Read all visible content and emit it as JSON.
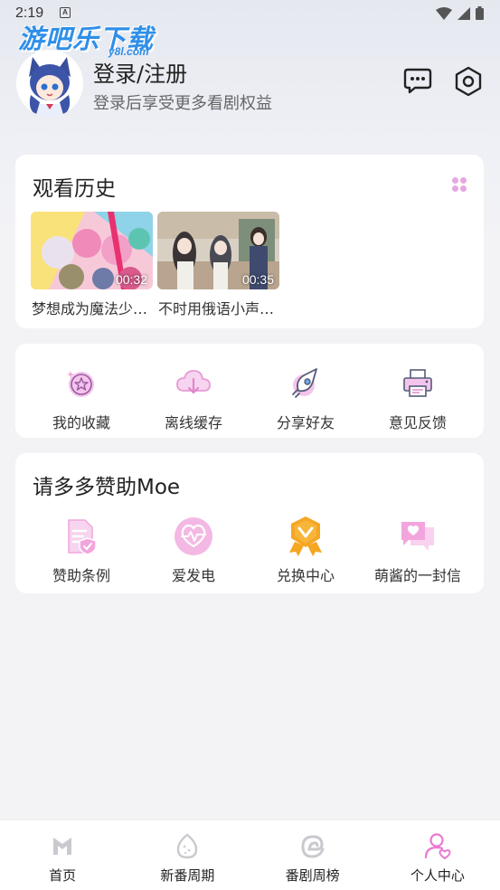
{
  "status_bar": {
    "time": "2:19",
    "a_badge": "A"
  },
  "watermark": {
    "main": "游吧乐下载",
    "sub": "y8l.com"
  },
  "header": {
    "title": "登录/注册",
    "subtitle": "登录后享受更多看剧权益"
  },
  "history": {
    "title": "观看历史",
    "items": [
      {
        "title": "梦想成为魔法少…",
        "time": "00:32"
      },
      {
        "title": "不时用俄语小声…",
        "time": "00:35"
      }
    ]
  },
  "tools": [
    {
      "label": "我的收藏",
      "icon": "star-badge-icon"
    },
    {
      "label": "离线缓存",
      "icon": "cloud-download-icon"
    },
    {
      "label": "分享好友",
      "icon": "share-rocket-icon"
    },
    {
      "label": "意见反馈",
      "icon": "feedback-printer-icon"
    }
  ],
  "sponsor": {
    "title": "请多多赞助Moe",
    "items": [
      {
        "label": "赞助条例",
        "icon": "document-shield-icon"
      },
      {
        "label": "爱发电",
        "icon": "heart-pulse-icon"
      },
      {
        "label": "兑换中心",
        "icon": "medal-icon"
      },
      {
        "label": "萌酱的一封信",
        "icon": "chat-heart-icon"
      }
    ]
  },
  "bottom_nav": [
    {
      "label": "首页",
      "icon": "home-m-icon",
      "active": false
    },
    {
      "label": "新番周期",
      "icon": "egg-icon",
      "active": false
    },
    {
      "label": "番剧周榜",
      "icon": "swirl-e-icon",
      "active": false
    },
    {
      "label": "个人中心",
      "icon": "person-heart-icon",
      "active": true
    }
  ],
  "colors": {
    "accent_pink": "#e87ad0",
    "icon_pink": "#f2a5dd",
    "medal_orange": "#f5a623",
    "watermark_blue": "#2f8fe8"
  }
}
